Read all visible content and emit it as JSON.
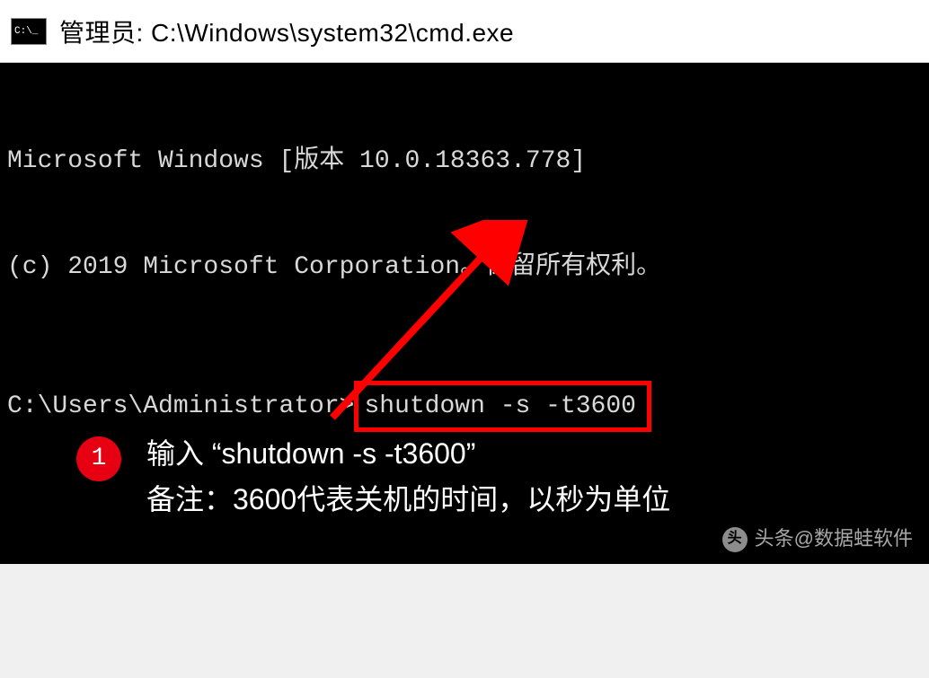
{
  "titlebar": {
    "text": "管理员: C:\\Windows\\system32\\cmd.exe"
  },
  "terminal": {
    "line1": "Microsoft Windows [版本 10.0.18363.778]",
    "line2": "(c) 2019 Microsoft Corporation。保留所有权利。",
    "prompt": "C:\\Users\\Administrator>",
    "command": "shutdown -s -t3600"
  },
  "annotation": {
    "step": "1",
    "line1": "输入 “shutdown -s -t3600”",
    "line2": "备注：3600代表关机的时间，以秒为单位"
  },
  "watermark": {
    "logo": "头",
    "prefix": "头条 ",
    "handle": "@数据蛙软件"
  }
}
